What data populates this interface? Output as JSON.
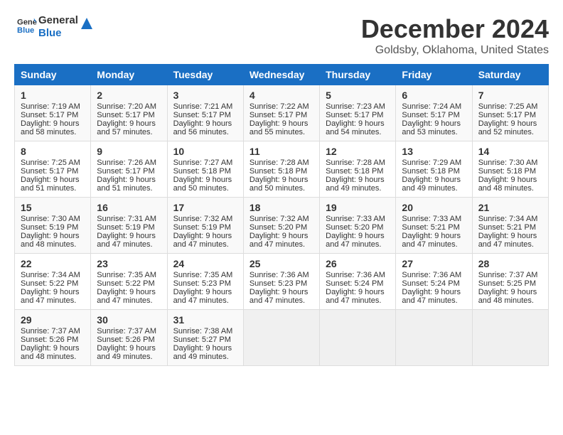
{
  "logo": {
    "line1": "General",
    "line2": "Blue"
  },
  "title": "December 2024",
  "location": "Goldsby, Oklahoma, United States",
  "days_header": [
    "Sunday",
    "Monday",
    "Tuesday",
    "Wednesday",
    "Thursday",
    "Friday",
    "Saturday"
  ],
  "weeks": [
    [
      {
        "day": "1",
        "info": "Sunrise: 7:19 AM\nSunset: 5:17 PM\nDaylight: 9 hours\nand 58 minutes."
      },
      {
        "day": "2",
        "info": "Sunrise: 7:20 AM\nSunset: 5:17 PM\nDaylight: 9 hours\nand 57 minutes."
      },
      {
        "day": "3",
        "info": "Sunrise: 7:21 AM\nSunset: 5:17 PM\nDaylight: 9 hours\nand 56 minutes."
      },
      {
        "day": "4",
        "info": "Sunrise: 7:22 AM\nSunset: 5:17 PM\nDaylight: 9 hours\nand 55 minutes."
      },
      {
        "day": "5",
        "info": "Sunrise: 7:23 AM\nSunset: 5:17 PM\nDaylight: 9 hours\nand 54 minutes."
      },
      {
        "day": "6",
        "info": "Sunrise: 7:24 AM\nSunset: 5:17 PM\nDaylight: 9 hours\nand 53 minutes."
      },
      {
        "day": "7",
        "info": "Sunrise: 7:25 AM\nSunset: 5:17 PM\nDaylight: 9 hours\nand 52 minutes."
      }
    ],
    [
      {
        "day": "8",
        "info": "Sunrise: 7:25 AM\nSunset: 5:17 PM\nDaylight: 9 hours\nand 51 minutes."
      },
      {
        "day": "9",
        "info": "Sunrise: 7:26 AM\nSunset: 5:17 PM\nDaylight: 9 hours\nand 51 minutes."
      },
      {
        "day": "10",
        "info": "Sunrise: 7:27 AM\nSunset: 5:18 PM\nDaylight: 9 hours\nand 50 minutes."
      },
      {
        "day": "11",
        "info": "Sunrise: 7:28 AM\nSunset: 5:18 PM\nDaylight: 9 hours\nand 50 minutes."
      },
      {
        "day": "12",
        "info": "Sunrise: 7:28 AM\nSunset: 5:18 PM\nDaylight: 9 hours\nand 49 minutes."
      },
      {
        "day": "13",
        "info": "Sunrise: 7:29 AM\nSunset: 5:18 PM\nDaylight: 9 hours\nand 49 minutes."
      },
      {
        "day": "14",
        "info": "Sunrise: 7:30 AM\nSunset: 5:18 PM\nDaylight: 9 hours\nand 48 minutes."
      }
    ],
    [
      {
        "day": "15",
        "info": "Sunrise: 7:30 AM\nSunset: 5:19 PM\nDaylight: 9 hours\nand 48 minutes."
      },
      {
        "day": "16",
        "info": "Sunrise: 7:31 AM\nSunset: 5:19 PM\nDaylight: 9 hours\nand 47 minutes."
      },
      {
        "day": "17",
        "info": "Sunrise: 7:32 AM\nSunset: 5:19 PM\nDaylight: 9 hours\nand 47 minutes."
      },
      {
        "day": "18",
        "info": "Sunrise: 7:32 AM\nSunset: 5:20 PM\nDaylight: 9 hours\nand 47 minutes."
      },
      {
        "day": "19",
        "info": "Sunrise: 7:33 AM\nSunset: 5:20 PM\nDaylight: 9 hours\nand 47 minutes."
      },
      {
        "day": "20",
        "info": "Sunrise: 7:33 AM\nSunset: 5:21 PM\nDaylight: 9 hours\nand 47 minutes."
      },
      {
        "day": "21",
        "info": "Sunrise: 7:34 AM\nSunset: 5:21 PM\nDaylight: 9 hours\nand 47 minutes."
      }
    ],
    [
      {
        "day": "22",
        "info": "Sunrise: 7:34 AM\nSunset: 5:22 PM\nDaylight: 9 hours\nand 47 minutes."
      },
      {
        "day": "23",
        "info": "Sunrise: 7:35 AM\nSunset: 5:22 PM\nDaylight: 9 hours\nand 47 minutes."
      },
      {
        "day": "24",
        "info": "Sunrise: 7:35 AM\nSunset: 5:23 PM\nDaylight: 9 hours\nand 47 minutes."
      },
      {
        "day": "25",
        "info": "Sunrise: 7:36 AM\nSunset: 5:23 PM\nDaylight: 9 hours\nand 47 minutes."
      },
      {
        "day": "26",
        "info": "Sunrise: 7:36 AM\nSunset: 5:24 PM\nDaylight: 9 hours\nand 47 minutes."
      },
      {
        "day": "27",
        "info": "Sunrise: 7:36 AM\nSunset: 5:24 PM\nDaylight: 9 hours\nand 47 minutes."
      },
      {
        "day": "28",
        "info": "Sunrise: 7:37 AM\nSunset: 5:25 PM\nDaylight: 9 hours\nand 48 minutes."
      }
    ],
    [
      {
        "day": "29",
        "info": "Sunrise: 7:37 AM\nSunset: 5:26 PM\nDaylight: 9 hours\nand 48 minutes."
      },
      {
        "day": "30",
        "info": "Sunrise: 7:37 AM\nSunset: 5:26 PM\nDaylight: 9 hours\nand 49 minutes."
      },
      {
        "day": "31",
        "info": "Sunrise: 7:38 AM\nSunset: 5:27 PM\nDaylight: 9 hours\nand 49 minutes."
      },
      {
        "day": "",
        "info": ""
      },
      {
        "day": "",
        "info": ""
      },
      {
        "day": "",
        "info": ""
      },
      {
        "day": "",
        "info": ""
      }
    ]
  ]
}
